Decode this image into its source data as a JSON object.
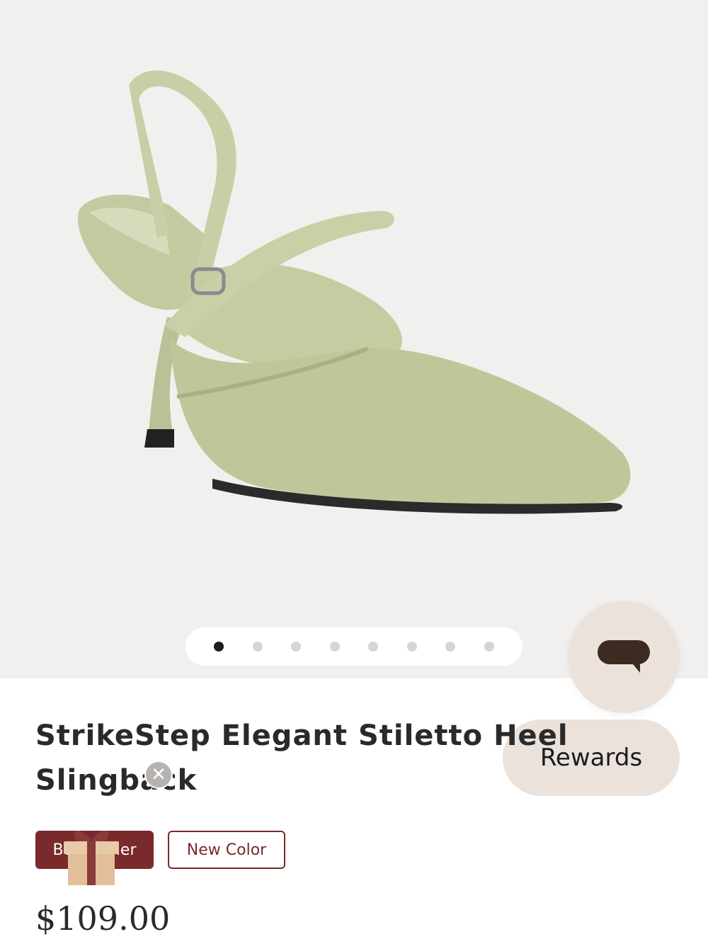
{
  "gallery": {
    "image_alt": "Sage green knit slingback stiletto heel",
    "dots": [
      true,
      false,
      false,
      false,
      false,
      false,
      false,
      false
    ]
  },
  "chat": {
    "icon": "chat-bubble-icon"
  },
  "rewards": {
    "label": "Rewards"
  },
  "product": {
    "title": "StrikeStep Elegant Stiletto Heel Slingback",
    "badges": {
      "best_seller": "Best Seller",
      "new_color": "New Color"
    },
    "price": "$109.00"
  },
  "colors": {
    "accent": "#7a2a2a",
    "gallery_bg": "#f1f0ee",
    "rewards_bg": "#ebe2dc",
    "shoe": "#c9d0a8"
  }
}
